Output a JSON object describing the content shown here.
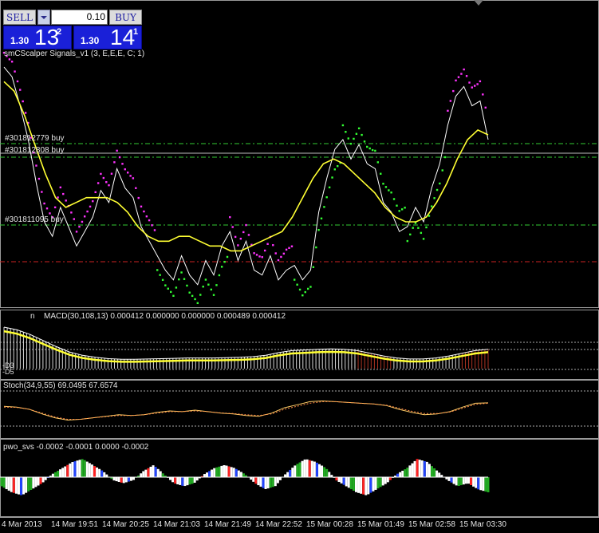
{
  "trade_panel": {
    "sell_label": "SELL",
    "buy_label": "BUY",
    "lot_value": "0.10",
    "sell_price": {
      "prefix": "1.30",
      "big": "13",
      "sup": "2"
    },
    "buy_price": {
      "prefix": "1.30",
      "big": "14",
      "sup": "1"
    }
  },
  "colors": {
    "background": "#000000",
    "price_line": "#ffffff",
    "ma_line": "#ffff33",
    "sar_up": "#33ff33",
    "sar_down": "#ff33ff",
    "order_line": "#33cc33",
    "sl_line": "#cc2222",
    "macd_hist": "#d8d8d8",
    "macd_hist_neg": "#aa3322",
    "stoch_main": "#ffcc66",
    "pwo_white": "#ffffff",
    "pwo_red": "#ff2222",
    "pwo_blue": "#2244ff",
    "pwo_green": "#22aa22"
  },
  "panels": {
    "main_label": "smCScalper Signals_v1 (3, E,E,E, C; 1)",
    "macd_label": "MACD(30,108,13) 0.000412 0.000000 0.000000 0.000489 0.000412",
    "macd_name_fragment": "n",
    "stoch_label": "Stoch(34,9,55) 69.0495 67.6574",
    "pwo_label": "pwo_svs -0.0002 -0.0001 0.0000 -0.0002"
  },
  "orders": [
    {
      "label": "#301812779 buy"
    },
    {
      "label": "#301812808 buy"
    },
    {
      "label": "#301811095 buy"
    }
  ],
  "macd_levels": [
    "-D3",
    "-D5"
  ],
  "time_axis": [
    "4 Mar 2013",
    "14 Mar 19:51",
    "14 Mar 20:25",
    "14 Mar 21:03",
    "14 Mar 21:49",
    "14 Mar 22:52",
    "15 Mar 00:28",
    "15 Mar 01:49",
    "15 Mar 02:58",
    "15 Mar 03:30"
  ],
  "chart_data": [
    {
      "type": "line",
      "panel": "main",
      "series": [
        {
          "values": [
            0.96,
            0.92,
            0.8,
            0.66,
            0.48,
            0.32,
            0.26,
            0.38,
            0.3,
            0.22,
            0.28,
            0.34,
            0.45,
            0.4,
            0.54,
            0.46,
            0.42,
            0.3,
            0.24,
            0.18,
            0.12,
            0.08,
            0.18,
            0.1,
            0.06,
            0.16,
            0.1,
            0.22,
            0.28,
            0.16,
            0.24,
            0.12,
            0.1,
            0.18,
            0.08,
            0.12,
            0.14,
            0.08,
            0.12,
            0.36,
            0.5,
            0.62,
            0.66,
            0.58,
            0.64,
            0.56,
            0.54,
            0.4,
            0.36,
            0.28,
            0.3,
            0.38,
            0.32,
            0.46,
            0.56,
            0.72,
            0.84,
            0.88,
            0.8,
            0.82,
            0.66
          ]
        },
        {
          "values": [
            0.9,
            0.86,
            0.76,
            0.64,
            0.52,
            0.42,
            0.38,
            0.4,
            0.42,
            0.42,
            0.42,
            0.4,
            0.36,
            0.3,
            0.26,
            0.24,
            0.24,
            0.26,
            0.26,
            0.24,
            0.22,
            0.22,
            0.2,
            0.2,
            0.22,
            0.24,
            0.26,
            0.28,
            0.34,
            0.42,
            0.5,
            0.56,
            0.58,
            0.56,
            0.52,
            0.48,
            0.44,
            0.38,
            0.34,
            0.32,
            0.32,
            0.34,
            0.4,
            0.48,
            0.58,
            0.66,
            0.7,
            0.68
          ]
        }
      ]
    },
    {
      "type": "area",
      "panel": "macd",
      "series": [
        {
          "values": [
            1.0,
            0.92,
            0.78,
            0.6,
            0.42,
            0.26,
            0.16,
            0.1,
            0.06,
            0.04,
            0.04,
            0.05,
            0.06,
            0.07,
            0.08,
            0.08,
            0.08,
            0.09,
            0.1,
            0.12,
            0.16,
            0.24,
            0.3,
            0.32,
            0.34,
            0.35,
            0.34,
            0.3,
            0.22,
            0.14,
            0.08,
            0.05,
            0.05,
            0.08,
            0.14,
            0.22,
            0.3,
            0.34
          ]
        }
      ]
    },
    {
      "type": "line",
      "panel": "stoch",
      "series": [
        {
          "values": [
            60,
            58,
            52,
            40,
            30,
            24,
            26,
            30,
            34,
            38,
            36,
            38,
            44,
            48,
            46,
            50,
            46,
            42,
            40,
            36,
            34,
            42,
            56,
            64,
            72,
            74,
            72,
            70,
            68,
            66,
            62,
            52,
            44,
            38,
            40,
            46,
            58,
            68,
            69
          ]
        },
        {
          "values": [
            58,
            57,
            52,
            42,
            32,
            26,
            26,
            30,
            33,
            36,
            36,
            38,
            42,
            46,
            46,
            48,
            46,
            43,
            41,
            38,
            36,
            40,
            52,
            60,
            68,
            72,
            72,
            70,
            68,
            66,
            63,
            55,
            47,
            41,
            41,
            45,
            55,
            65,
            68
          ]
        }
      ]
    },
    {
      "type": "bar",
      "panel": "pwo",
      "series": [
        {
          "values": [
            -0.3,
            -0.5,
            -0.6,
            -0.4,
            -0.2,
            0.1,
            0.3,
            0.5,
            0.6,
            0.4,
            0.2,
            -0.1,
            -0.2,
            -0.1,
            0.2,
            0.4,
            0.1,
            -0.2,
            -0.3,
            -0.2,
            0.1,
            0.3,
            0.4,
            0.3,
            0.1,
            -0.2,
            -0.4,
            -0.3,
            0.1,
            0.4,
            0.6,
            0.5,
            0.3,
            -0.1,
            -0.3,
            -0.5,
            -0.6,
            -0.4,
            -0.2,
            0.1,
            0.3,
            0.6,
            0.5,
            0.2,
            -0.1,
            -0.3,
            -0.2,
            -0.4,
            -0.5
          ]
        }
      ]
    }
  ]
}
